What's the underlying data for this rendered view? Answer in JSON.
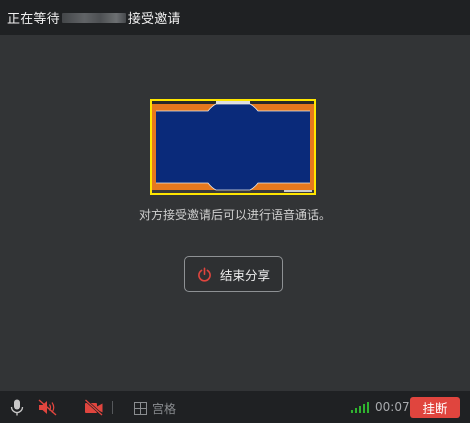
{
  "window": {
    "title_prefix": "正在等待",
    "title_suffix": "接受邀请"
  },
  "main": {
    "hint_text": "对方接受邀请后可以进行语音通话。",
    "end_share_label": "结束分享"
  },
  "toolbar": {
    "grid_label": "宫格",
    "timer": "00:07",
    "hangup_label": "挂断"
  },
  "icons": {
    "mic": "microphone-icon",
    "speaker": "speaker-muted-icon",
    "camera": "camera-off-icon",
    "grid": "grid-icon",
    "signal": "signal-icon",
    "power": "power-icon"
  },
  "colors": {
    "highlight_border": "#ffe600",
    "danger": "#e0453e",
    "signal": "#2fb52f",
    "share_background": "#0a2a7a",
    "share_frame": "#e6781e"
  }
}
